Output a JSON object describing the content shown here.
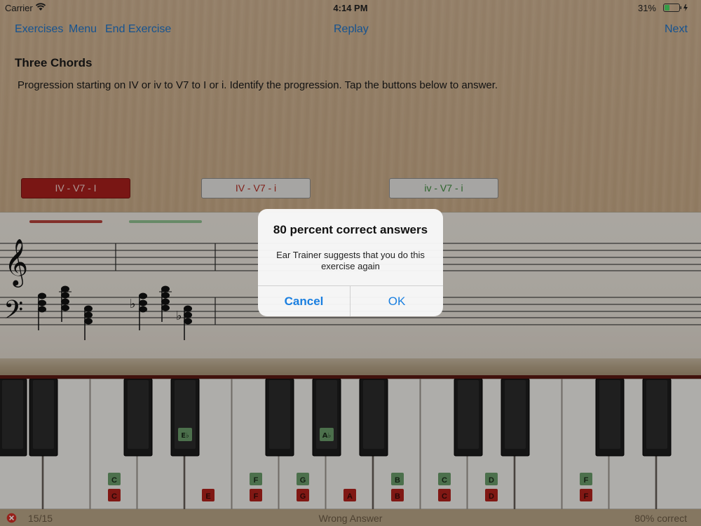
{
  "status": {
    "carrier": "Carrier",
    "time": "4:14 PM",
    "battery": "31%",
    "icons": [
      "wifi-icon",
      "battery-icon",
      "charging-icon"
    ]
  },
  "nav": {
    "exercises": "Exercises",
    "menu": "Menu",
    "end_exercise": "End Exercise",
    "replay": "Replay",
    "next": "Next"
  },
  "exercise": {
    "title": "Three Chords",
    "description": "Progression starting on IV or iv to V7 to I or i. Identify the progression. Tap the buttons below to answer."
  },
  "answers": [
    "IV - V7 - I",
    "IV - V7 - i",
    "iv - V7 - i"
  ],
  "colors": {
    "accent": "#1f74c8",
    "wrong": "#a81f1c",
    "correct": "#5d9a5d",
    "dialog_button": "#1a7fe0"
  },
  "keyboard": {
    "white_labels": [
      {
        "note": "C",
        "green": "C",
        "red": "C"
      },
      {
        "note": "E",
        "red": "E"
      },
      {
        "note": "F",
        "green": "F",
        "red": "F"
      },
      {
        "note": "G",
        "green": "G",
        "red": "G"
      },
      {
        "note": "A",
        "red": "A"
      },
      {
        "note": "B",
        "green": "B",
        "red": "B"
      },
      {
        "note": "C",
        "green": "C",
        "red": "C"
      },
      {
        "note": "D",
        "green": "D",
        "red": "D"
      },
      {
        "note": "F",
        "green": "F",
        "red": "F"
      }
    ],
    "black_labels": [
      "E♭",
      "A♭"
    ]
  },
  "bottom": {
    "progress": "15/15",
    "feedback": "Wrong Answer",
    "score": "80% correct"
  },
  "dialog": {
    "title": "80 percent correct answers",
    "message": "Ear Trainer suggests that you do this exercise again",
    "cancel": "Cancel",
    "ok": "OK"
  }
}
